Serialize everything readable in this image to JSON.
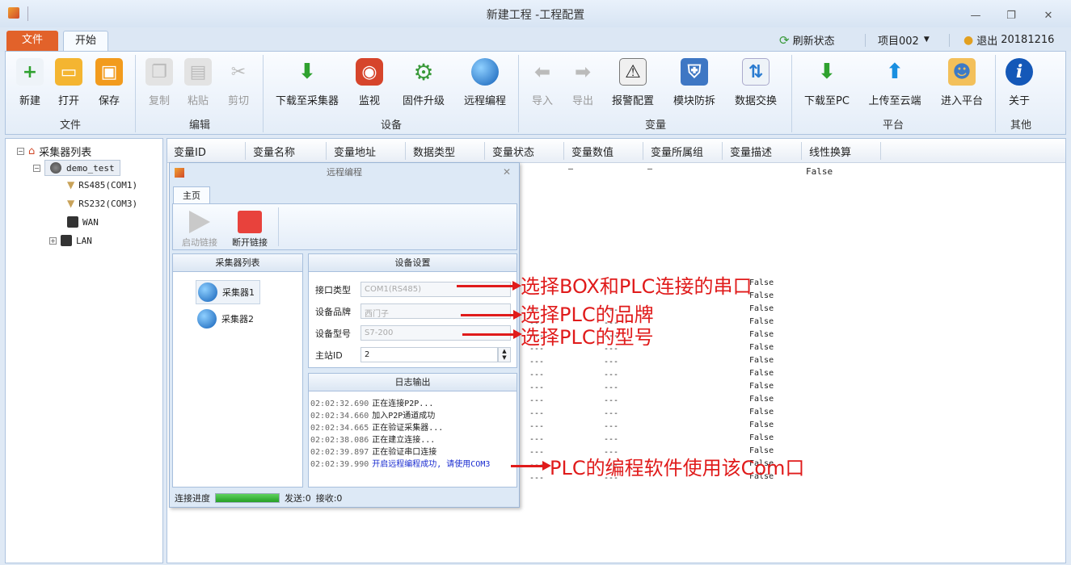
{
  "window": {
    "title": "新建工程 -工程配置",
    "min": "—",
    "max": "❐",
    "close": "✕"
  },
  "ribbon_tabs": [
    "文件",
    "开始"
  ],
  "quick": {
    "refresh": "刷新状态",
    "project": "项目002",
    "logout": "退出",
    "date": "20181216"
  },
  "groups": [
    {
      "name": "文件",
      "tools": [
        "新建",
        "打开",
        "保存"
      ]
    },
    {
      "name": "编辑",
      "tools": [
        "复制",
        "粘贴",
        "剪切"
      ]
    },
    {
      "name": "设备",
      "tools": [
        "下载至采集器",
        "监视",
        "固件升级",
        "远程编程"
      ]
    },
    {
      "name": "变量",
      "tools": [
        "导入",
        "导出",
        "报警配置",
        "模块防拆",
        "数据交换"
      ]
    },
    {
      "name": "平台",
      "tools": [
        "下载至PC",
        "上传至云端",
        "进入平台"
      ]
    },
    {
      "name": "其他",
      "tools": [
        "关于"
      ]
    }
  ],
  "tree": {
    "root": "采集器列表",
    "device": "demo_test",
    "children": [
      "RS485(COM1)",
      "RS232(COM3)",
      "WAN",
      "LAN"
    ]
  },
  "grid": {
    "columns": [
      "变量ID",
      "变量名称",
      "变量地址",
      "数据类型",
      "变量状态",
      "变量数值",
      "变量所属组",
      "变量描述",
      "线性换算"
    ],
    "first_row": {
      "value": "—",
      "group": "—",
      "linear": "False"
    },
    "dash": "---",
    "bool": "False"
  },
  "dialog": {
    "title": "远程编程",
    "tab": "主页",
    "start": "启动链接",
    "stop": "断开链接",
    "list_title": "采集器列表",
    "collectors": [
      "采集器1",
      "采集器2"
    ],
    "settings_title": "设备设置",
    "fields": [
      {
        "label": "接口类型",
        "value": "COM1(RS485)"
      },
      {
        "label": "设备品牌",
        "value": "西门子"
      },
      {
        "label": "设备型号",
        "value": "S7-200"
      },
      {
        "label": "主站ID",
        "value": "2"
      }
    ],
    "log_title": "日志输出",
    "log": [
      {
        "time": "02:02:32.690",
        "msg": "正在连接P2P..."
      },
      {
        "time": "02:02:34.660",
        "msg": "加入P2P通道成功"
      },
      {
        "time": "02:02:34.665",
        "msg": "正在验证采集器..."
      },
      {
        "time": "02:02:38.086",
        "msg": "正在建立连接..."
      },
      {
        "time": "02:02:39.897",
        "msg": "正在验证串口连接"
      },
      {
        "time": "02:02:39.990",
        "msg": "开启远程编程成功, 请使用COM3"
      }
    ],
    "progress_label": "连接进度",
    "progress": 1.0,
    "sent": "发送:0",
    "recv": "接收:0"
  },
  "annotations": [
    "选择BOX和PLC连接的串口",
    "选择PLC的品牌",
    "选择PLC的型号",
    "PLC的编程软件使用该Com口"
  ]
}
